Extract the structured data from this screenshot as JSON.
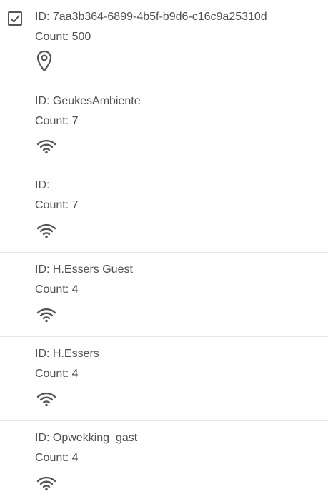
{
  "items": [
    {
      "id_label": "ID: 7aa3b364-6899-4b5f-b9d6-c16c9a25310d",
      "count_label": "Count: 500",
      "icon": "location-pin-icon",
      "checked": true
    },
    {
      "id_label": "ID: GeukesAmbiente",
      "count_label": "Count: 7",
      "icon": "wifi-icon",
      "checked": false
    },
    {
      "id_label": "ID:",
      "count_label": "Count: 7",
      "icon": "wifi-icon",
      "checked": false
    },
    {
      "id_label": "ID: H.Essers Guest",
      "count_label": "Count: 4",
      "icon": "wifi-icon",
      "checked": false
    },
    {
      "id_label": "ID: H.Essers",
      "count_label": "Count: 4",
      "icon": "wifi-icon",
      "checked": false
    },
    {
      "id_label": "ID: Opwekking_gast",
      "count_label": "Count: 4",
      "icon": "wifi-icon",
      "checked": false
    }
  ],
  "colors": {
    "text": "#4f4f4f",
    "divider": "#e8e8e8",
    "icon": "#555555"
  }
}
